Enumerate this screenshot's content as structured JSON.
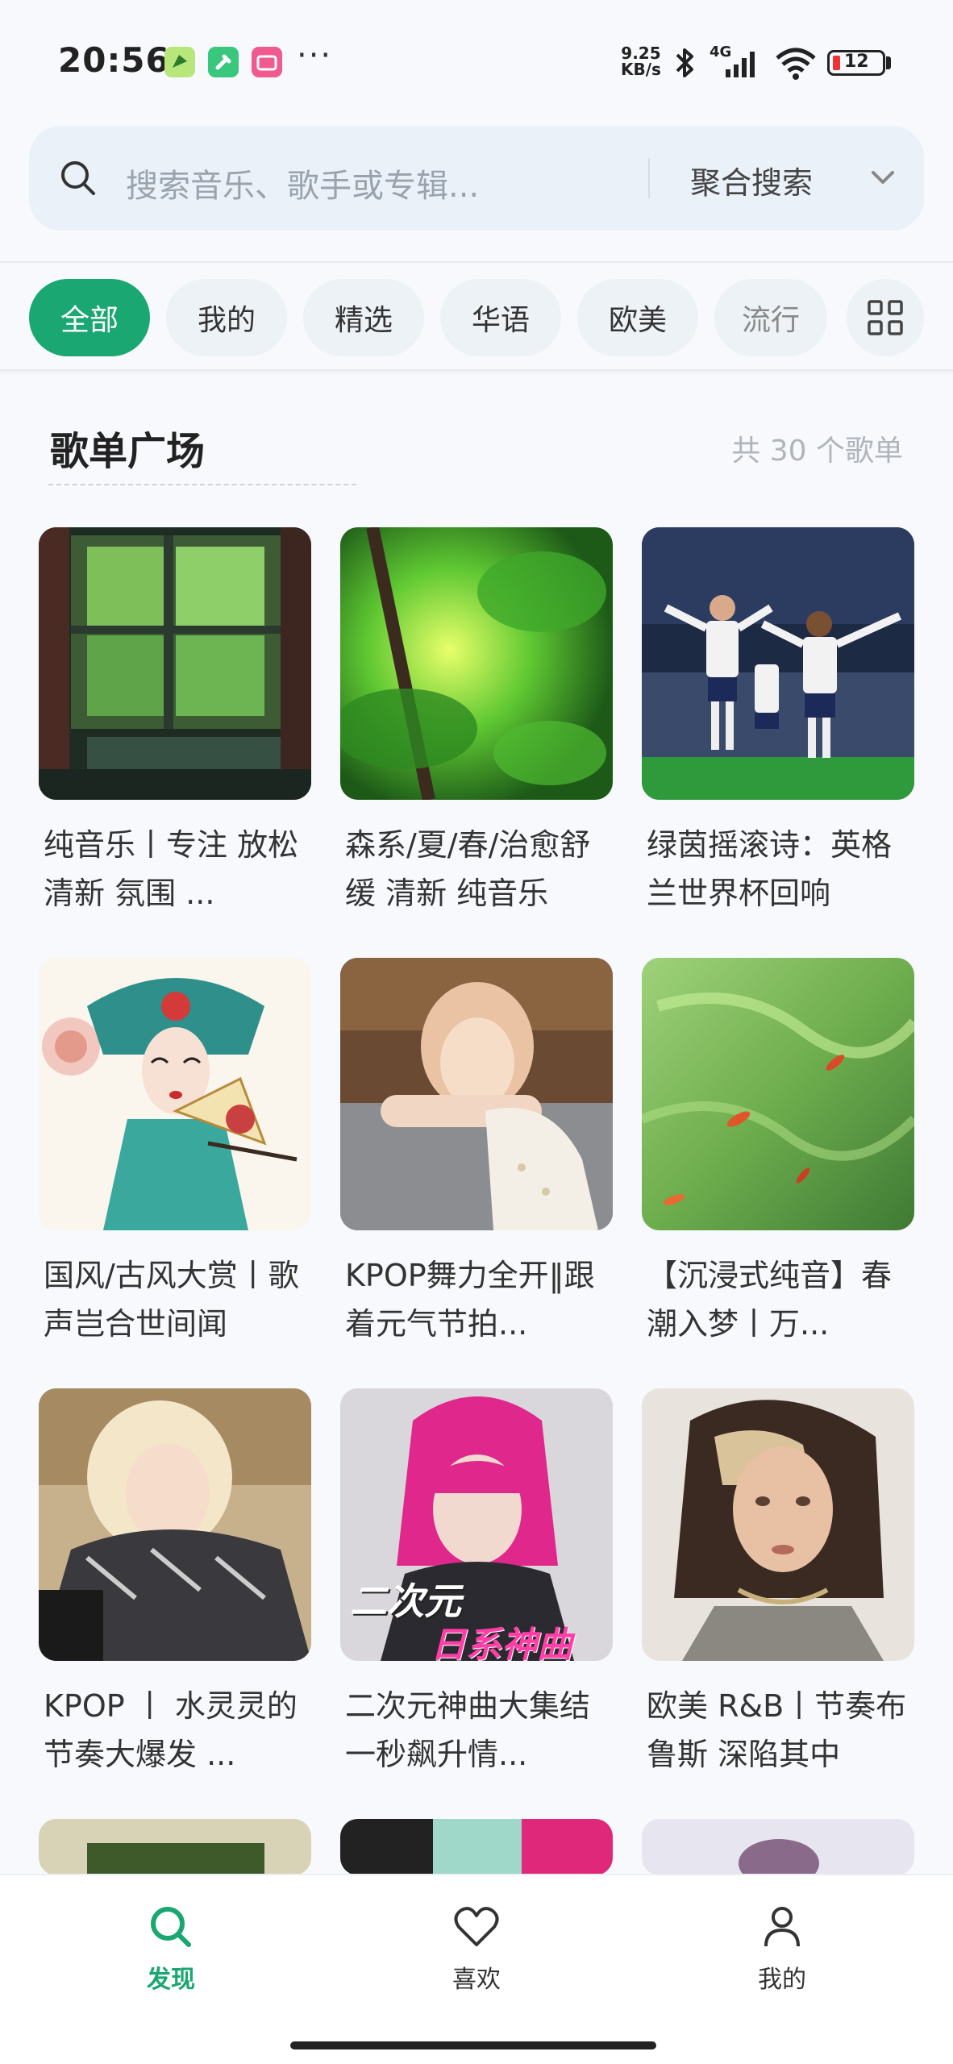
{
  "status_bar": {
    "time": "20:56",
    "net_speed_value": "9.25",
    "net_speed_unit": "KB/s",
    "network_type": "4G",
    "battery_level": "12",
    "more_indicator": "···",
    "app_icons": [
      "feishu-app-icon",
      "tools-app-icon",
      "bilibili-app-icon"
    ]
  },
  "search": {
    "placeholder": "搜索音乐、歌手或专辑...",
    "mode_label": "聚合搜索"
  },
  "tabs": [
    {
      "label": "全部",
      "active": true
    },
    {
      "label": "我的",
      "active": false
    },
    {
      "label": "精选",
      "active": false
    },
    {
      "label": "华语",
      "active": false
    },
    {
      "label": "欧美",
      "active": false
    },
    {
      "label": "流行",
      "active": false
    }
  ],
  "section": {
    "title": "歌单广场",
    "count_text": "共 30 个歌单"
  },
  "playlists": [
    {
      "title": "纯音乐丨专注 放松 清新 氛围 ...",
      "cover": "window-classroom-image"
    },
    {
      "title": "森系/夏/春/治愈舒缓 清新 纯音乐",
      "cover": "green-leaves-image"
    },
    {
      "title": "绿茵摇滚诗：英格兰世界杯回响",
      "cover": "football-players-image"
    },
    {
      "title": "国风/古风大赏丨歌声岂合世间闻",
      "cover": "peking-opera-illustration"
    },
    {
      "title": "KPOP舞力全开‖跟着元气节拍...",
      "cover": "kpop-singer-portrait"
    },
    {
      "title": "【沉浸式纯音】春潮入梦丨万...",
      "cover": "koi-pond-image"
    },
    {
      "title": "KPOP 丨 水灵灵的节奏大爆发 ...",
      "cover": "blonde-singer-portrait"
    },
    {
      "title": "二次元神曲大集结 一秒飙升情...",
      "cover": "anime-song-cover",
      "cover_text_1": "二次元",
      "cover_text_2": "日系神曲"
    },
    {
      "title": "欧美 R&B丨节奏布鲁斯 深陷其中",
      "cover": "rnb-portrait"
    }
  ],
  "bottom_nav": [
    {
      "label": "发现",
      "icon": "search-icon",
      "active": true
    },
    {
      "label": "喜欢",
      "icon": "heart-icon",
      "active": false
    },
    {
      "label": "我的",
      "icon": "user-icon",
      "active": false
    }
  ],
  "colors": {
    "accent": "#1aa772",
    "background": "#f7f9fc",
    "pill": "#edf2f7"
  }
}
